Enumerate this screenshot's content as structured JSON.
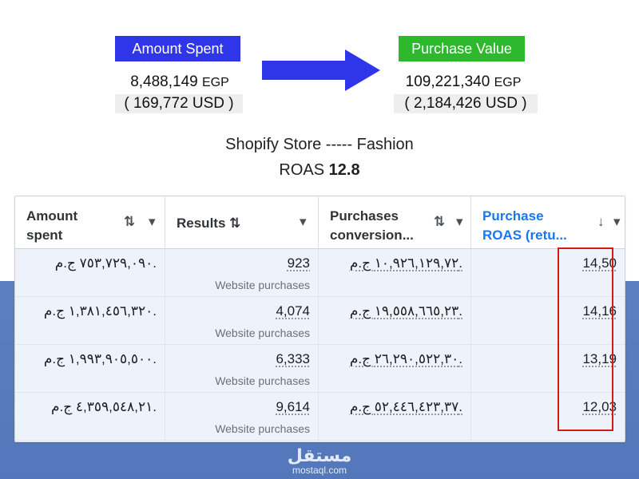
{
  "summary": {
    "spent_label": "Amount Spent",
    "spent_egp": "8,488,149",
    "spent_unit": "EGP",
    "spent_usd": "( 169,772 USD )",
    "value_label": "Purchase Value",
    "value_egp": "109,221,340",
    "value_unit": "EGP",
    "value_usd": "( 2,184,426 USD )",
    "store_line": "Shopify Store ----- Fashion",
    "roas_label": "ROAS",
    "roas_value": "12.8"
  },
  "colors": {
    "spent_badge": "#2f35e8",
    "value_badge": "#2eb82e",
    "arrow": "#2f35e8",
    "highlight": "#d31b1b",
    "link_header": "#1877f2"
  },
  "table": {
    "headers": [
      {
        "line1": "Amount",
        "line2": "spent",
        "sort_icon": "⇅",
        "menu_icon": "▾"
      },
      {
        "line1": "Results",
        "line2": "",
        "sort_icon": "⇅",
        "menu_icon": "▾"
      },
      {
        "line1": "Purchases",
        "line2": "conversion...",
        "sort_icon": "⇅",
        "menu_icon": "▾"
      },
      {
        "line1": "Purchase",
        "line2": "ROAS (retu...",
        "sort_icon": "↓",
        "menu_icon": "▾"
      }
    ],
    "rows": [
      {
        "spent": "٧٥٣,٧٢٩,٠٩٠ ج.م.",
        "results": "923",
        "results_sub": "Website purchases",
        "conv": "١٠,٩٢٦,١٢٩,٧٢ ج.م.",
        "roas": "14,50"
      },
      {
        "spent": "١,٣٨١,٤٥٦,٣٢٠ ج.م.",
        "results": "4,074",
        "results_sub": "Website purchases",
        "conv": "١٩,٥٥٨,٦٦٥,٢٣ ج.م.",
        "roas": "14,16"
      },
      {
        "spent": "١,٩٩٣,٩٠٥,٥٠٠ ج.م.",
        "results": "6,333",
        "results_sub": "Website purchases",
        "conv": "٢٦,٢٩٠,٥٢٢,٣٠ ج.م.",
        "roas": "13,19"
      },
      {
        "spent": "٤,٣٥٩,٥٤٨,٢١ ج.م.",
        "results": "9,614",
        "results_sub": "Website purchases",
        "conv": "٥٢,٤٤٦,٤٢٣,٣٧ ج.م.",
        "roas": "12,03"
      }
    ]
  },
  "watermark": {
    "arabic": "مستقل",
    "latin": "mostaql.com"
  }
}
